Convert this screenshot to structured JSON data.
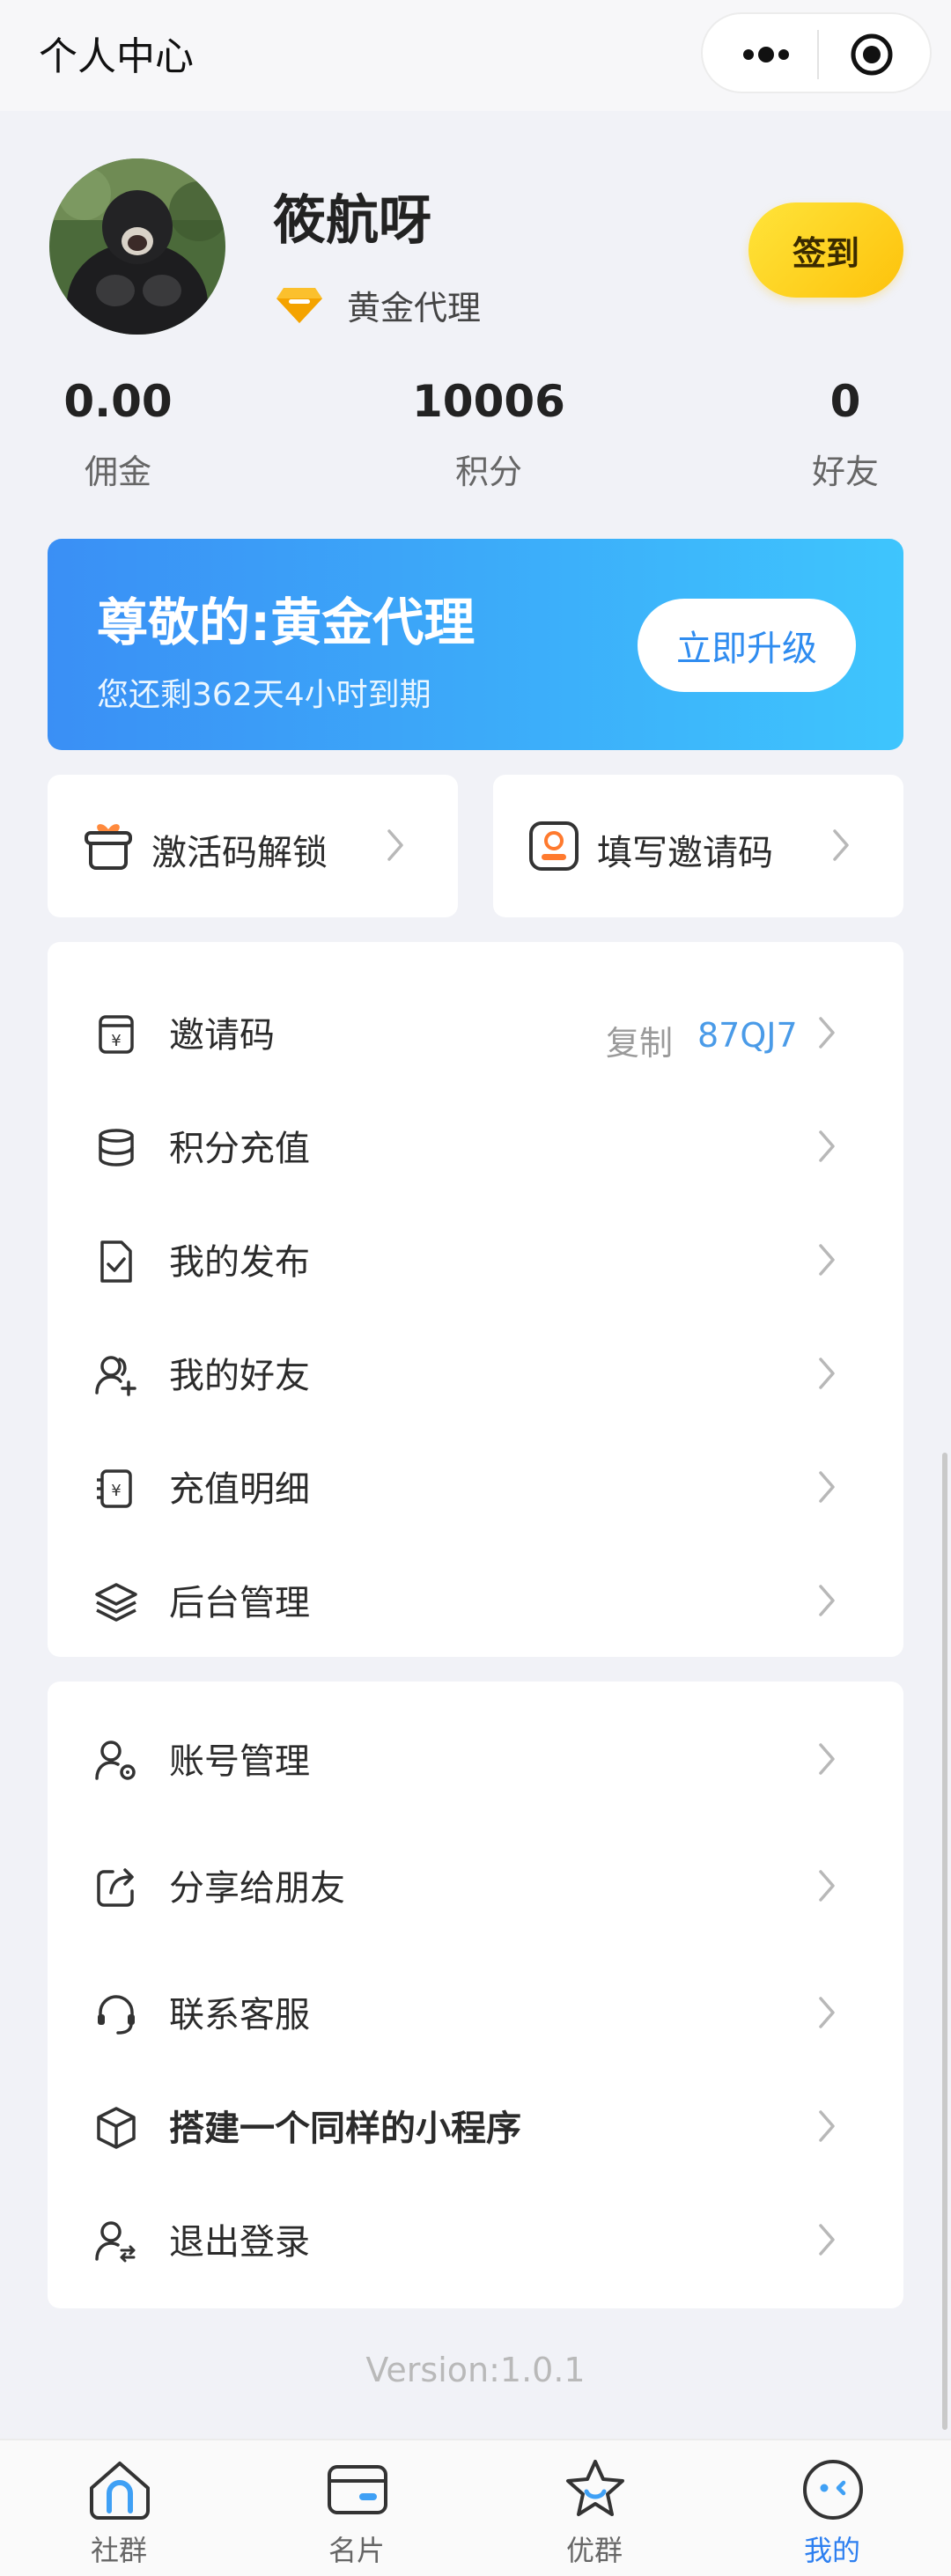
{
  "header": {
    "title": "个人中心"
  },
  "profile": {
    "name": "筱航呀",
    "level": "黄金代理",
    "signin_label": "签到",
    "stats": [
      {
        "value": "0.00",
        "label": "佣金"
      },
      {
        "value": "10006",
        "label": "积分"
      },
      {
        "value": "0",
        "label": "好友"
      }
    ]
  },
  "vip": {
    "title": "尊敬的:黄金代理",
    "subtitle": "您还剩362天4小时到期",
    "upgrade_label": "立即升级"
  },
  "quick_actions": [
    {
      "label": "激活码解锁",
      "icon": "gift-icon"
    },
    {
      "label": "填写邀请码",
      "icon": "invite-badge-icon"
    }
  ],
  "menu1": [
    {
      "label": "邀请码",
      "icon": "invite-code-icon",
      "copy": "复制",
      "code": "87QJ7"
    },
    {
      "label": "积分充值",
      "icon": "coins-icon"
    },
    {
      "label": "我的发布",
      "icon": "document-check-icon"
    },
    {
      "label": "我的好友",
      "icon": "user-add-icon"
    },
    {
      "label": "充值明细",
      "icon": "recharge-detail-icon"
    },
    {
      "label": "后台管理",
      "icon": "layers-icon"
    }
  ],
  "menu2": [
    {
      "label": "账号管理",
      "icon": "user-settings-icon"
    },
    {
      "label": "分享给朋友",
      "icon": "share-icon"
    },
    {
      "label": "联系客服",
      "icon": "headset-icon"
    },
    {
      "label": "搭建一个同样的小程序",
      "icon": "cube-icon"
    },
    {
      "label": "退出登录",
      "icon": "user-logout-icon"
    }
  ],
  "version": "Version:1.0.1",
  "tabs": [
    {
      "label": "社群",
      "icon": "community-icon"
    },
    {
      "label": "名片",
      "icon": "card-icon"
    },
    {
      "label": "优群",
      "icon": "star-icon"
    },
    {
      "label": "我的",
      "icon": "profile-face-icon",
      "active": true
    }
  ],
  "colors": {
    "accent": "#2d7ff0",
    "signin": "#fdd21f",
    "vip_start": "#3a8ff5",
    "vip_end": "#3ec5fd"
  }
}
